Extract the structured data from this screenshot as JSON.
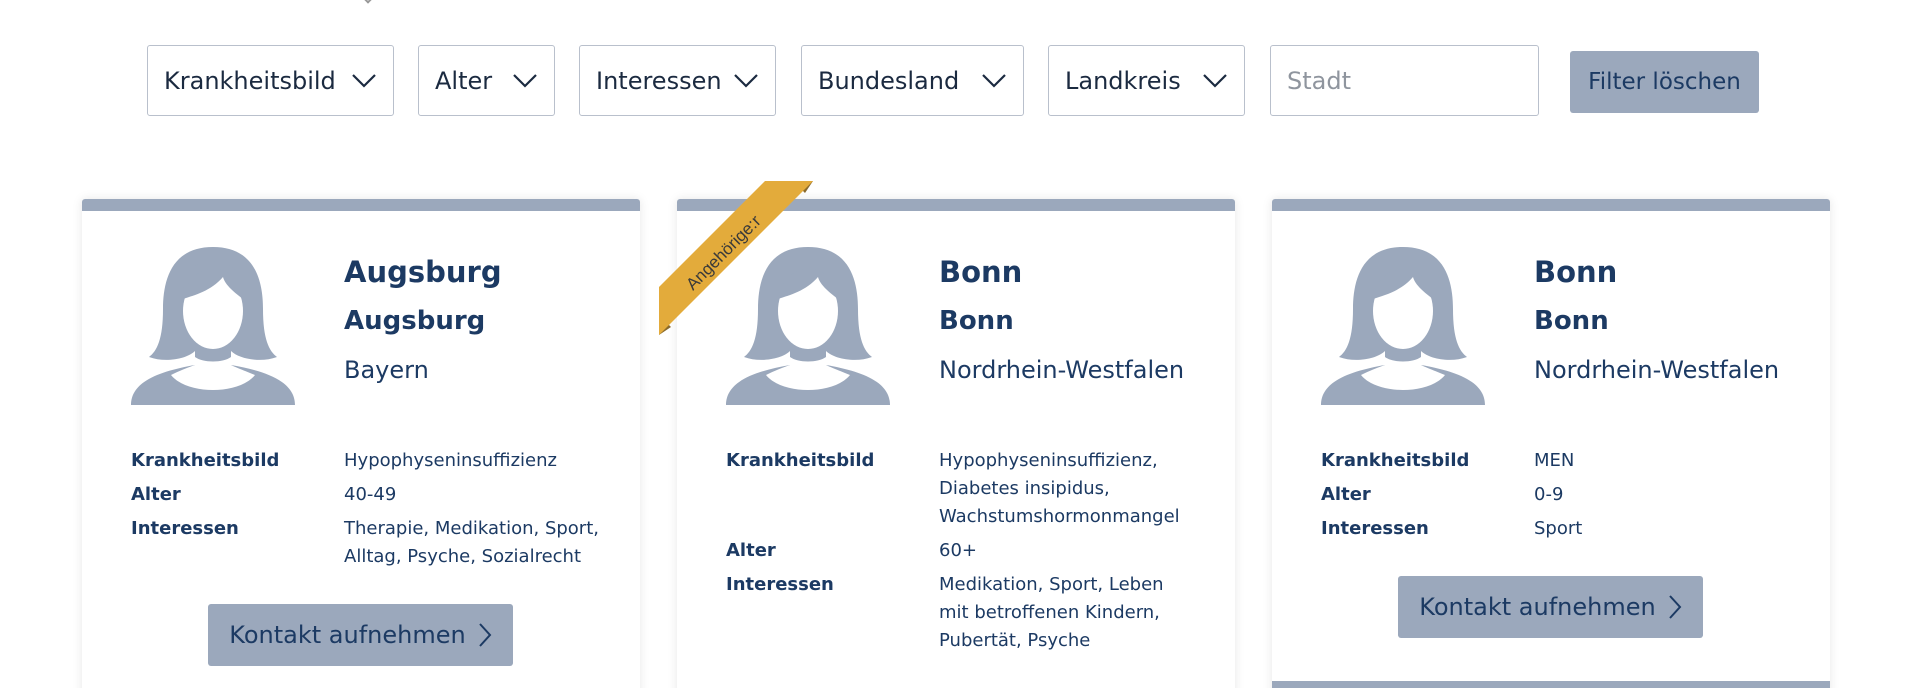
{
  "filters": {
    "krankheitsbild": "Krankheitsbild",
    "alter": "Alter",
    "interessen": "Interessen",
    "bundesland": "Bundesland",
    "landkreis": "Landkreis",
    "stadt_placeholder": "Stadt",
    "clear_label": "Filter löschen"
  },
  "labels": {
    "krankheitsbild": "Krankheitsbild",
    "alter": "Alter",
    "interessen": "Interessen",
    "contact": "Kontakt aufnehmen"
  },
  "colors": {
    "accent": "#9ba8bc",
    "text": "#1c3a63",
    "ribbon": "#e3ab3b",
    "ribbon_shadow": "#8a6a2c"
  },
  "cards": [
    {
      "city": "Augsburg",
      "district": "Augsburg",
      "state": "Bayern",
      "krankheitsbild": "Hypophyseninsuffizienz",
      "alter": "40-49",
      "interessen_lines": [
        "Therapie, Medikation, Sport,",
        "Alltag, Psyche, Sozialrecht"
      ]
    },
    {
      "ribbon": "Angehörige:r",
      "city": "Bonn",
      "district": "Bonn",
      "state": "Nordrhein-Westfalen",
      "krankheitsbild_lines": [
        "Hypophyseninsuffizienz,",
        "Diabetes insipidus,",
        "Wachstumshormonmangel"
      ],
      "alter": "60+",
      "interessen_lines": [
        "Medikation, Sport, Leben",
        "mit betroffenen Kindern,",
        "Pubertät, Psyche"
      ]
    },
    {
      "city": "Bonn",
      "district": "Bonn",
      "state": "Nordrhein-Westfalen",
      "krankheitsbild": "MEN",
      "alter": "0-9",
      "interessen": "Sport"
    }
  ]
}
